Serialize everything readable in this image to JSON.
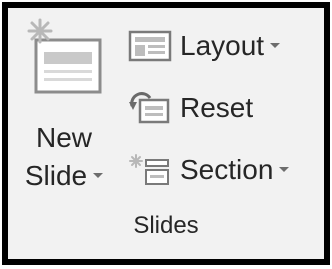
{
  "group": {
    "label": "Slides"
  },
  "new_slide": {
    "line1": "New",
    "line2": "Slide",
    "icon": "new-slide-icon"
  },
  "buttons": [
    {
      "label": "Layout",
      "icon": "layout-icon",
      "has_dropdown": true
    },
    {
      "label": "Reset",
      "icon": "reset-icon",
      "has_dropdown": false
    },
    {
      "label": "Section",
      "icon": "section-icon",
      "has_dropdown": true
    }
  ],
  "colors": {
    "frame": "#000000",
    "background": "#f2f2f2",
    "text": "#262626",
    "accent": "#c7c7c7"
  }
}
